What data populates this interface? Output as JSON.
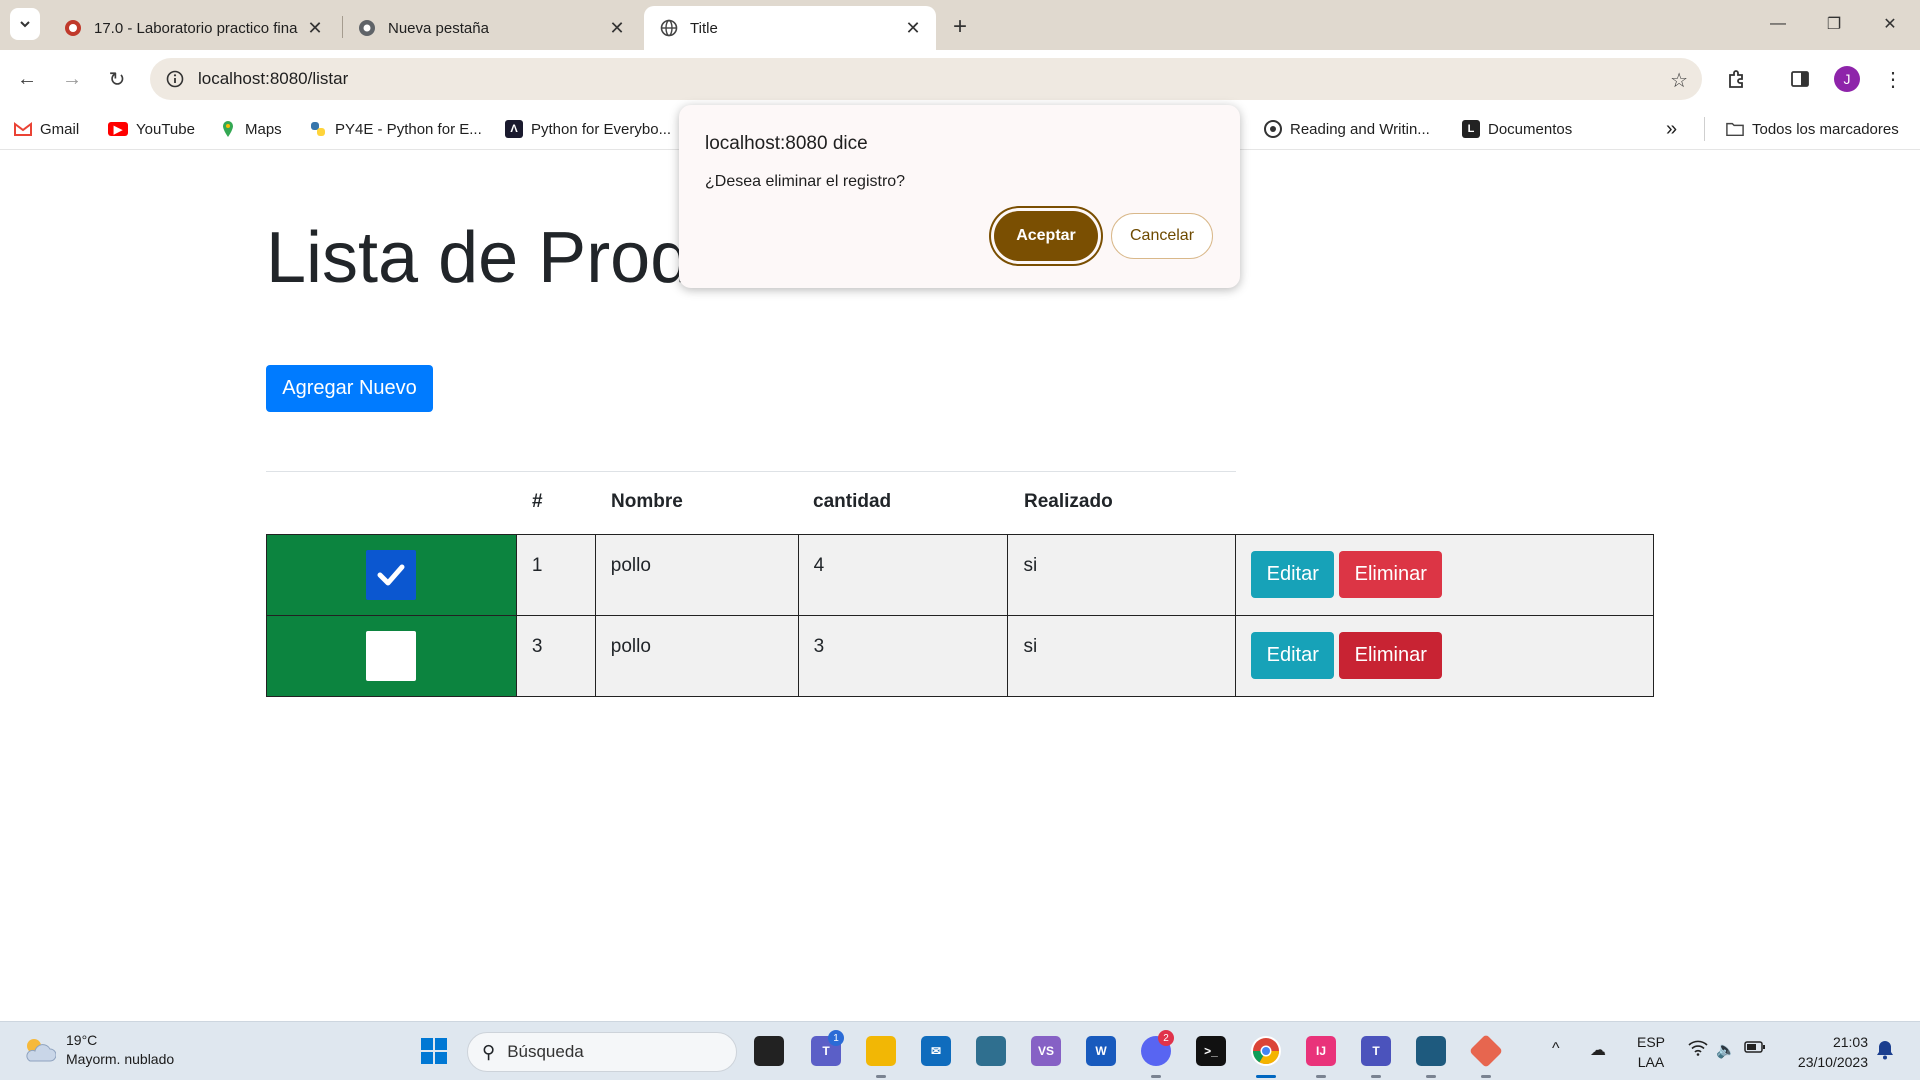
{
  "browser": {
    "tabs": [
      {
        "title": "17.0 - Laboratorio practico fina",
        "active": false
      },
      {
        "title": "Nueva pestaña",
        "active": false
      },
      {
        "title": "Title",
        "active": true
      }
    ],
    "new_tab": "+",
    "url": "localhost:8080/listar",
    "profile_initial": "J",
    "bookmarks": [
      "Gmail",
      "YouTube",
      "Maps",
      "PY4E - Python for E...",
      "Python for Everybo...",
      "Reading and Writin...",
      "Documentos"
    ],
    "all_bookmarks": "Todos los marcadores",
    "overflow": "»"
  },
  "page": {
    "title": "Lista de Produ",
    "add_button": "Agregar Nuevo",
    "columns": [
      "#",
      "Nombre",
      "cantidad",
      "Realizado"
    ],
    "rows": [
      {
        "checked": true,
        "id": "1",
        "nombre": "pollo",
        "cantidad": "4",
        "realizado": "si",
        "edit": "Editar",
        "delete": "Eliminar"
      },
      {
        "checked": false,
        "id": "3",
        "nombre": "pollo",
        "cantidad": "3",
        "realizado": "si",
        "edit": "Editar",
        "delete": "Eliminar"
      }
    ]
  },
  "dialog": {
    "origin": "localhost:8080 dice",
    "message": "¿Desea eliminar el registro?",
    "accept": "Aceptar",
    "cancel": "Cancelar"
  },
  "taskbar": {
    "weather_temp": "19°C",
    "weather_desc": "Mayorm. nublado",
    "search_placeholder": "Búsqueda",
    "badge_teams": "1",
    "badge_discord": "2",
    "lang_1": "ESP",
    "lang_2": "LAA",
    "time": "21:03",
    "date": "23/10/2023"
  },
  "colors": {
    "primary": "#007bff",
    "info": "#17a2b8",
    "danger": "#dc3545",
    "check_cell": "#0c843f",
    "dialog_accept": "#7a4f02"
  }
}
